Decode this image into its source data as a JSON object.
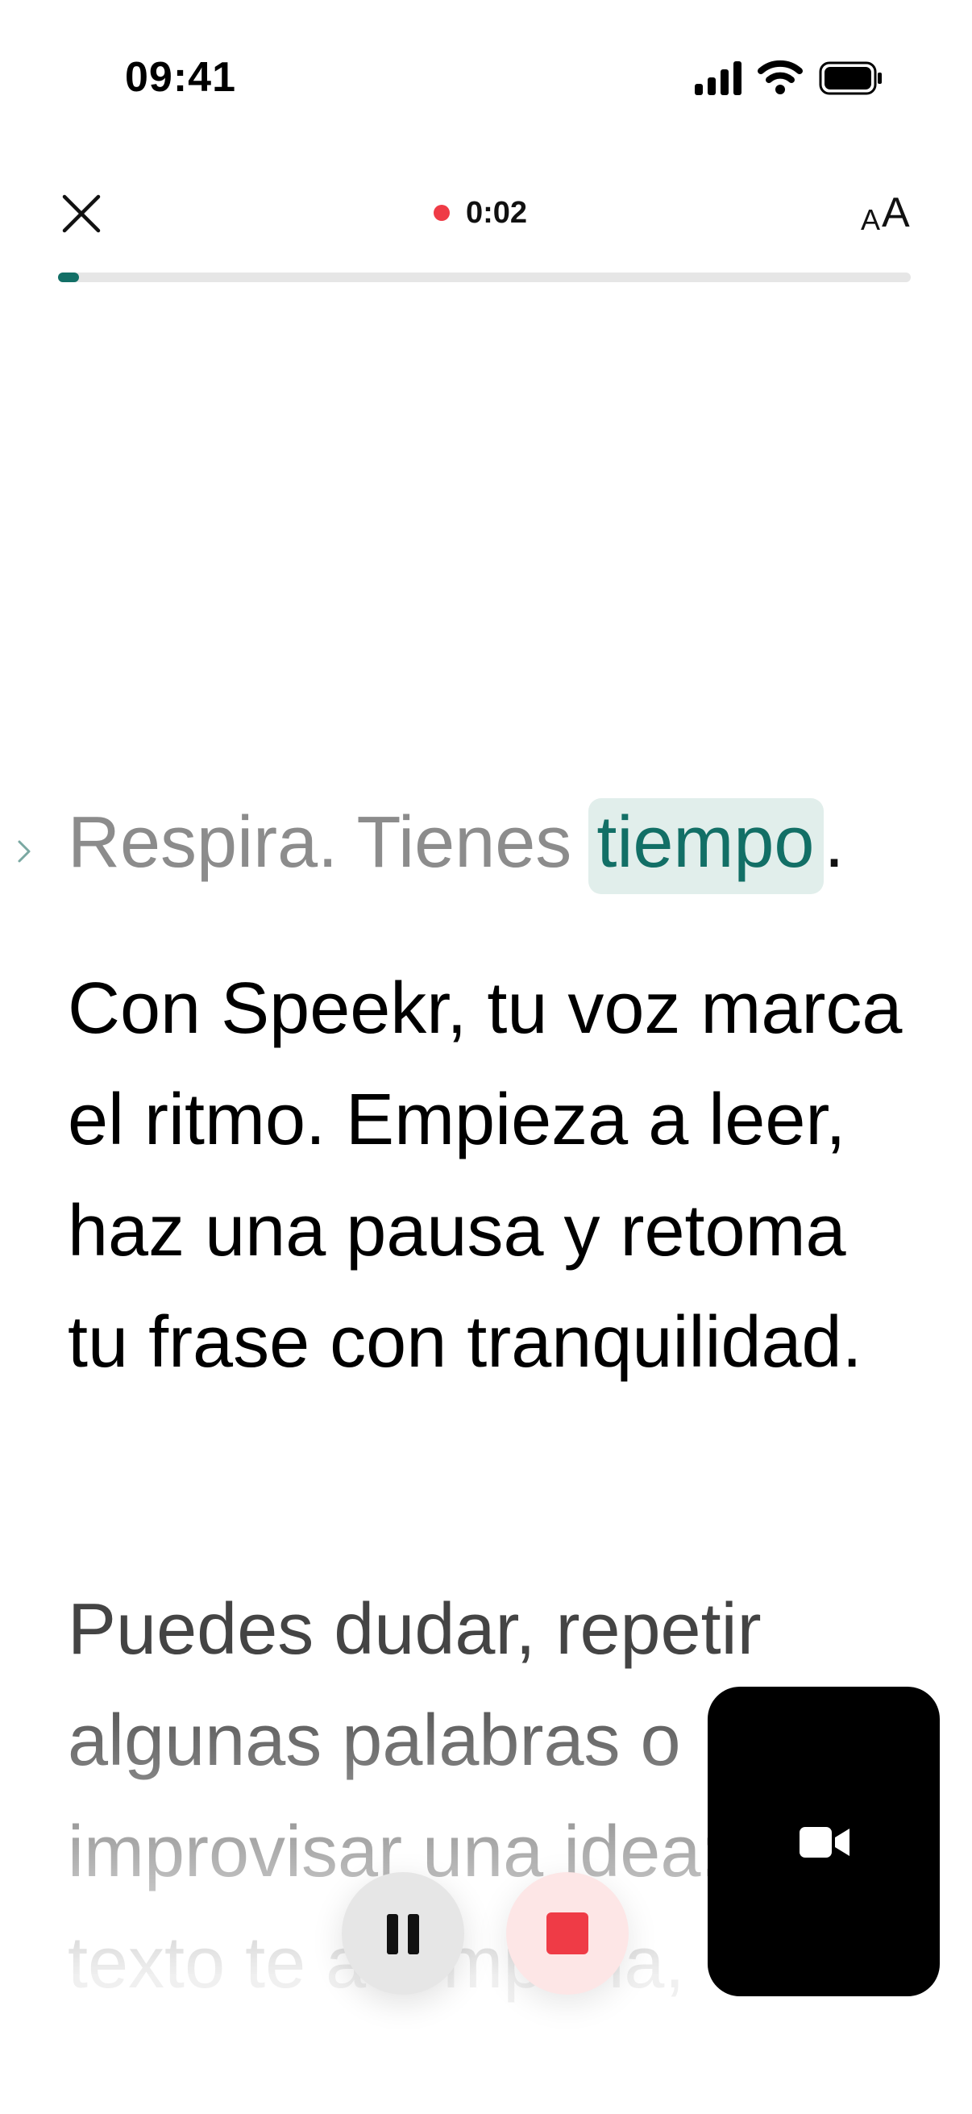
{
  "status_bar": {
    "time": "09:41",
    "signal_icon": "cellular-signal-icon",
    "wifi_icon": "wifi-icon",
    "battery_icon": "battery-icon"
  },
  "top_bar": {
    "close_icon": "close-icon",
    "recording_time": "0:02",
    "recording_dot_color": "#ef3b46",
    "text_size_small": "A",
    "text_size_large": "A"
  },
  "progress": {
    "fraction": 0.025,
    "fill_color": "#126f66"
  },
  "script": {
    "line1_before": "Respira. Tienes ",
    "line1_highlight": "tiempo",
    "line1_after": ".",
    "paragraph2": "Con Speekr, tu voz marca el ritmo. Empieza a leer, haz una pausa y retoma tu frase con tranquilidad.",
    "paragraph3": "Puedes dudar, repetir algunas palabras o improvisar una idea: el texto te acompaña, "
  },
  "controls": {
    "pause_icon": "pause-icon",
    "stop_icon": "stop-icon",
    "camera_icon": "video-camera-icon"
  },
  "colors": {
    "accent": "#126f66",
    "highlight_bg": "#e1eeeb",
    "record_red": "#ef3b46"
  }
}
